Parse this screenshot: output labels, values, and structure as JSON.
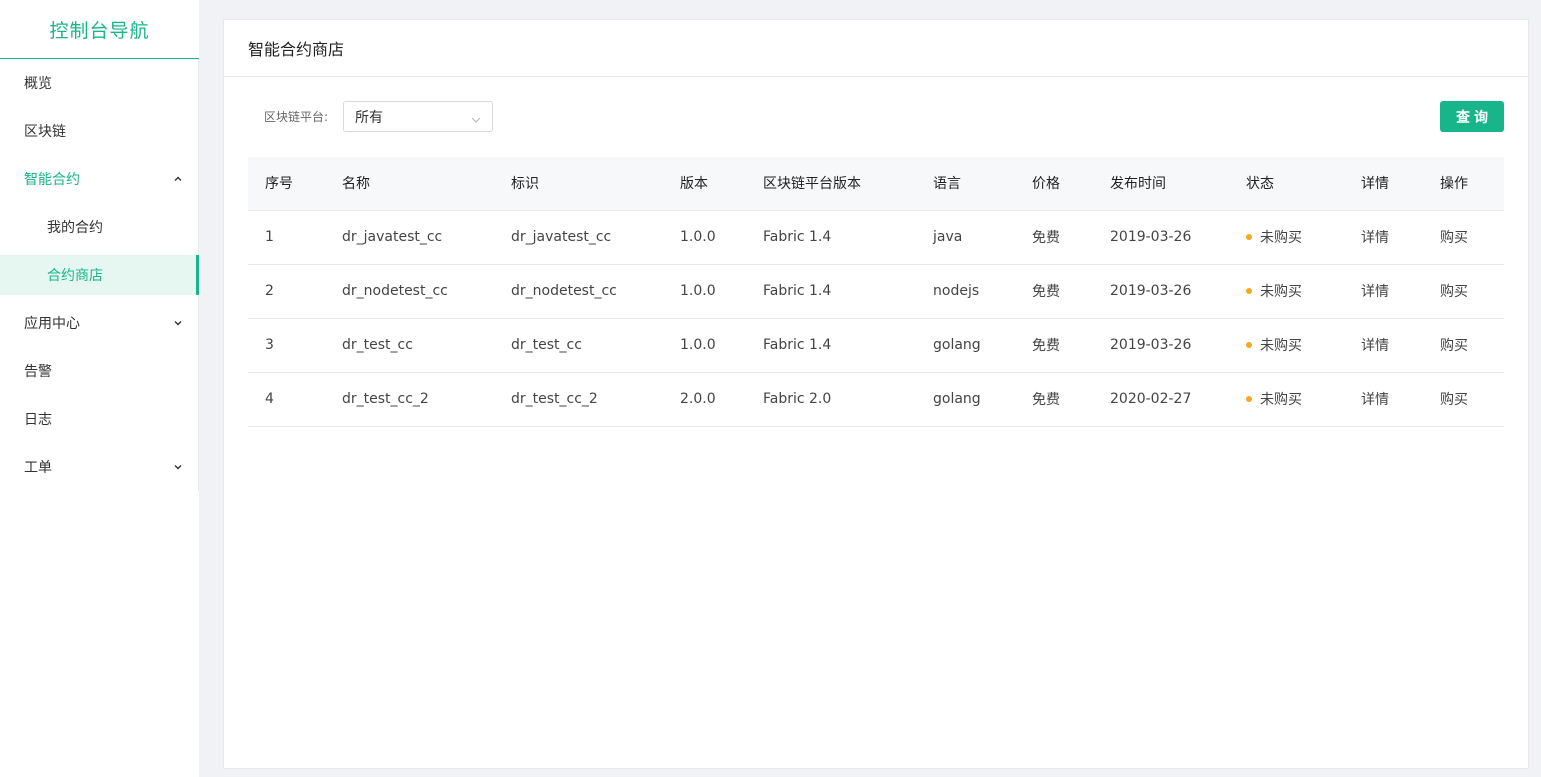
{
  "sidebar": {
    "title": "控制台导航",
    "items": [
      {
        "label": "概览"
      },
      {
        "label": "区块链"
      },
      {
        "label": "智能合约"
      },
      {
        "label": "我的合约"
      },
      {
        "label": "合约商店"
      },
      {
        "label": "应用中心"
      },
      {
        "label": "告警"
      },
      {
        "label": "日志"
      },
      {
        "label": "工单"
      }
    ]
  },
  "page": {
    "title": "智能合约商店"
  },
  "filter": {
    "label": "区块链平台:",
    "selected": "所有",
    "query_button": "查询"
  },
  "table": {
    "columns": [
      "序号",
      "名称",
      "标识",
      "版本",
      "区块链平台版本",
      "语言",
      "价格",
      "发布时间",
      "状态",
      "详情",
      "操作"
    ],
    "rows": [
      {
        "index": "1",
        "name": "dr_javatest_cc",
        "id": "dr_javatest_cc",
        "version": "1.0.0",
        "platform": "Fabric 1.4",
        "language": "java",
        "price": "免费",
        "date": "2019-03-26",
        "status": "未购买",
        "detail": "详情",
        "action": "购买"
      },
      {
        "index": "2",
        "name": "dr_nodetest_cc",
        "id": "dr_nodetest_cc",
        "version": "1.0.0",
        "platform": "Fabric 1.4",
        "language": "nodejs",
        "price": "免费",
        "date": "2019-03-26",
        "status": "未购买",
        "detail": "详情",
        "action": "购买"
      },
      {
        "index": "3",
        "name": "dr_test_cc",
        "id": "dr_test_cc",
        "version": "1.0.0",
        "platform": "Fabric 1.4",
        "language": "golang",
        "price": "免费",
        "date": "2019-03-26",
        "status": "未购买",
        "detail": "详情",
        "action": "购买"
      },
      {
        "index": "4",
        "name": "dr_test_cc_2",
        "id": "dr_test_cc_2",
        "version": "2.0.0",
        "platform": "Fabric 2.0",
        "language": "golang",
        "price": "免费",
        "date": "2020-02-27",
        "status": "未购买",
        "detail": "详情",
        "action": "购买"
      }
    ]
  },
  "colors": {
    "accent": "#18b48a",
    "price": "#e0732a",
    "status_dot": "#f5a623"
  },
  "icons": {
    "menu_expanded": "chevron-up-icon",
    "menu_collapsed": "chevron-down-icon",
    "select_arrow": "chevron-down-icon",
    "status": "status-dot-icon"
  }
}
